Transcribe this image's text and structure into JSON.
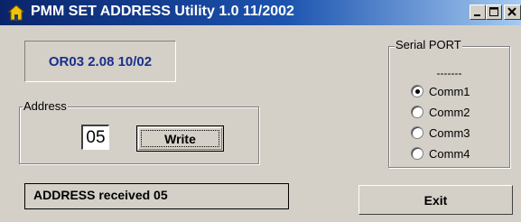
{
  "window": {
    "title": "PMM SET ADDRESS Utility 1.0 11/2002",
    "icon": "home-icon",
    "controls": [
      "minimize-icon",
      "maximize-icon",
      "close-icon"
    ]
  },
  "version": {
    "text": "OR03 2.08 10/02",
    "color": "#1b2f8a"
  },
  "address": {
    "legend": "Address",
    "value": "05",
    "write_label": "Write"
  },
  "serial": {
    "legend": "Serial PORT",
    "dashes": "-------",
    "options": [
      {
        "label": "Comm1",
        "selected": true
      },
      {
        "label": "Comm2",
        "selected": false
      },
      {
        "label": "Comm3",
        "selected": false
      },
      {
        "label": "Comm4",
        "selected": false
      }
    ]
  },
  "status": {
    "text": "ADDRESS received 05"
  },
  "exit": {
    "label": "Exit"
  },
  "colors": {
    "title_bar_start": "#0a246a",
    "title_bar_end": "#a6caf0",
    "face": "#d4d0c8"
  }
}
